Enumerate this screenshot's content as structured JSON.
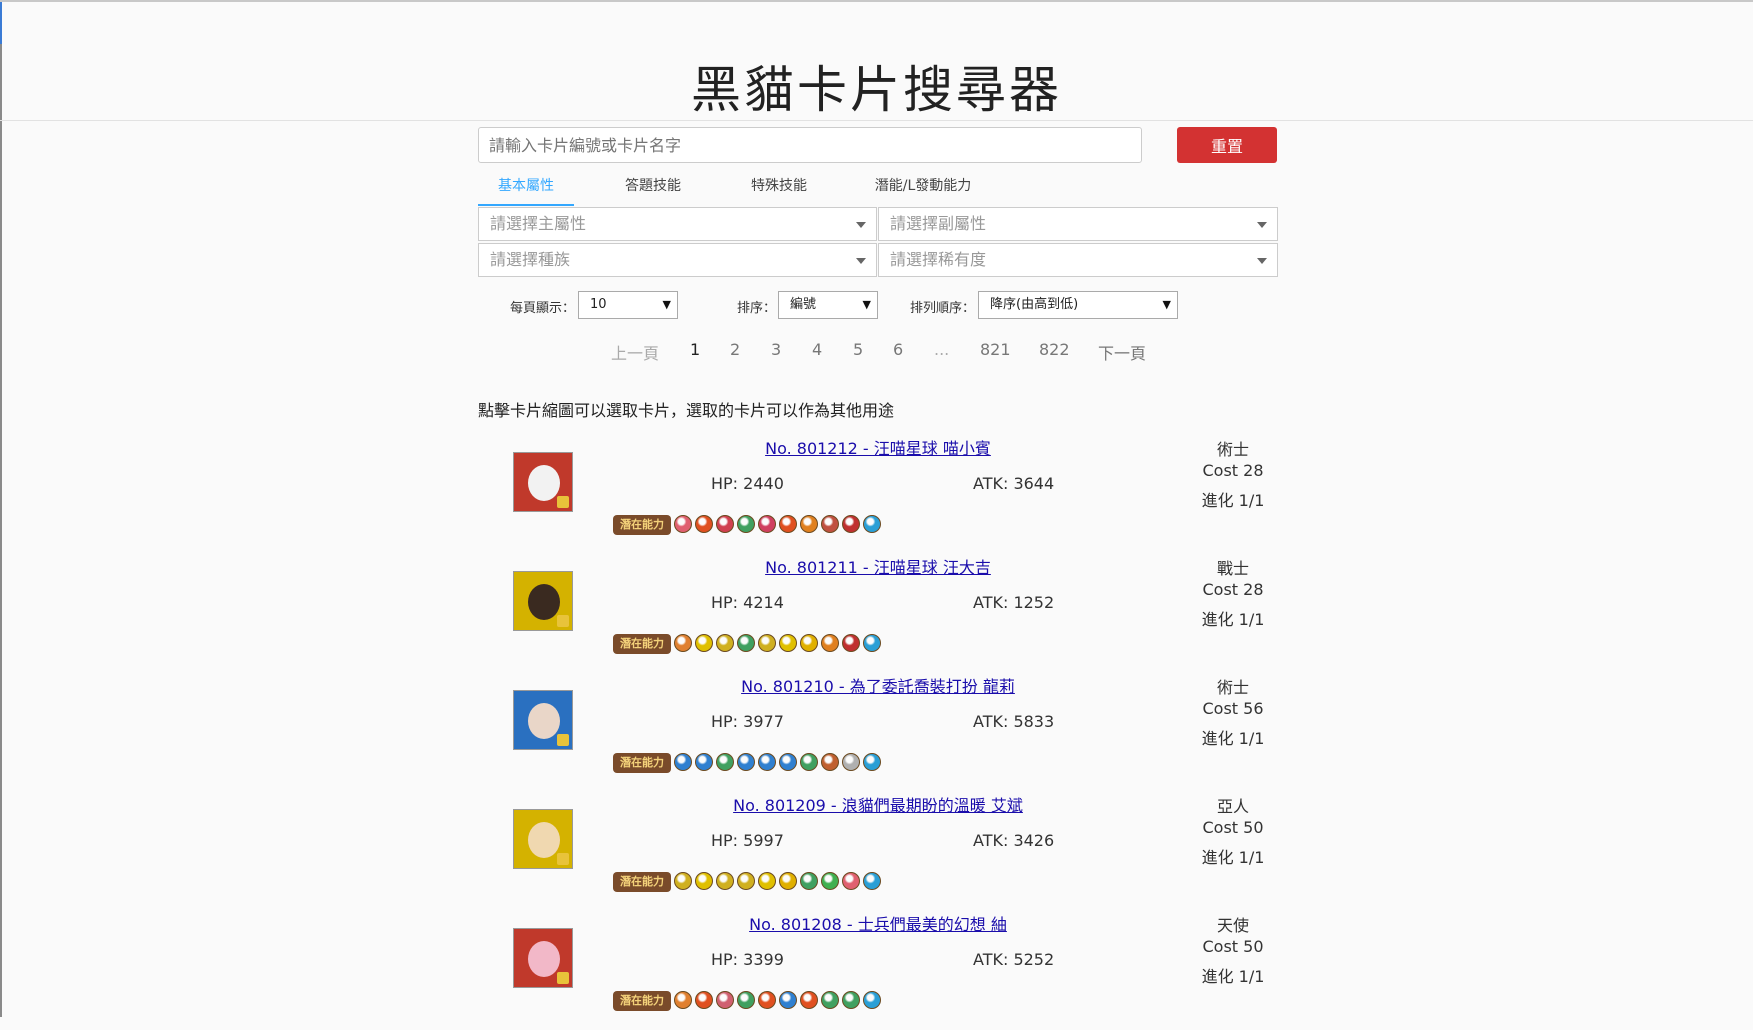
{
  "header": {
    "title": "黑貓卡片搜尋器"
  },
  "search": {
    "placeholder": "請輸入卡片編號或卡片名字",
    "reset_label": "重置"
  },
  "tabs": [
    "基本屬性",
    "答題技能",
    "特殊技能",
    "潛能/L發動能力"
  ],
  "filters": {
    "main_attr": "請選擇主屬性",
    "sub_attr": "請選擇副屬性",
    "race": "請選擇種族",
    "rarity": "請選擇稀有度"
  },
  "controls": {
    "per_page_label": "每頁顯示：",
    "per_page_value": "10",
    "sort_label": "排序：",
    "sort_value": "編號",
    "order_label": "排列順序：",
    "order_value": "降序(由高到低)"
  },
  "pagination": {
    "prev": "上一頁",
    "pages": [
      "1",
      "2",
      "3",
      "4",
      "5",
      "6",
      "...",
      "821",
      "822"
    ],
    "next": "下一頁",
    "current": "1"
  },
  "hint": "點擊卡片縮圖可以選取卡片，選取的卡片可以作為其他用途",
  "potential_label": "潛在能力",
  "cards": [
    {
      "name": "No. 801212 - 汪喵星球 喵小賓",
      "hp": "HP: 2440",
      "atk": "ATK: 3644",
      "race": "術士",
      "cost": "Cost 28",
      "evo": "進化 1/1",
      "frame_color": "#c0392b",
      "face_color": "#f2f2f2",
      "orbs": [
        "#e06070",
        "#e05020",
        "#d04050",
        "#40a060",
        "#d04060",
        "#e05020",
        "#e08020",
        "#c05040",
        "#c03030",
        "#2a9fd6"
      ]
    },
    {
      "name": "No. 801211 - 汪喵星球 汪大吉",
      "hp": "HP: 4214",
      "atk": "ATK: 1252",
      "race": "戰士",
      "cost": "Cost 28",
      "evo": "進化 1/1",
      "frame_color": "#d4b200",
      "face_color": "#3a2a20",
      "orbs": [
        "#e08030",
        "#e0c000",
        "#d0b020",
        "#40a060",
        "#d0b020",
        "#e0c000",
        "#e0b000",
        "#e08020",
        "#c03030",
        "#2a9fd6"
      ]
    },
    {
      "name": "No. 801210 - 為了委託喬裝打扮 龍莉",
      "hp": "HP: 3977",
      "atk": "ATK: 5833",
      "race": "術士",
      "cost": "Cost 56",
      "evo": "進化 1/1",
      "frame_color": "#2a70c0",
      "face_color": "#e9d6c8",
      "orbs": [
        "#3080d0",
        "#3080d0",
        "#40a060",
        "#3080d0",
        "#3080d0",
        "#3080d0",
        "#40a060",
        "#c06030",
        "#b0b0b0",
        "#2a9fd6"
      ]
    },
    {
      "name": "No. 801209 - 浪貓們最期盼的溫暖 艾斌",
      "hp": "HP: 5997",
      "atk": "ATK: 3426",
      "race": "亞人",
      "cost": "Cost 50",
      "evo": "進化 1/1",
      "frame_color": "#d4b200",
      "face_color": "#f0d8b0",
      "orbs": [
        "#d0b020",
        "#e0c000",
        "#d0b020",
        "#d0b020",
        "#e0c000",
        "#e0b000",
        "#40a060",
        "#40b050",
        "#e06070",
        "#2a9fd6"
      ]
    },
    {
      "name": "No. 801208 - 士兵們最美的幻想 紬",
      "hp": "HP: 3399",
      "atk": "ATK: 5252",
      "race": "天使",
      "cost": "Cost 50",
      "evo": "進化 1/1",
      "frame_color": "#c0392b",
      "face_color": "#f2b8c8",
      "orbs": [
        "#e08030",
        "#e05020",
        "#d06070",
        "#40a060",
        "#e05020",
        "#3080d0",
        "#e05020",
        "#40a060",
        "#40a060",
        "#2a9fd6"
      ]
    }
  ]
}
